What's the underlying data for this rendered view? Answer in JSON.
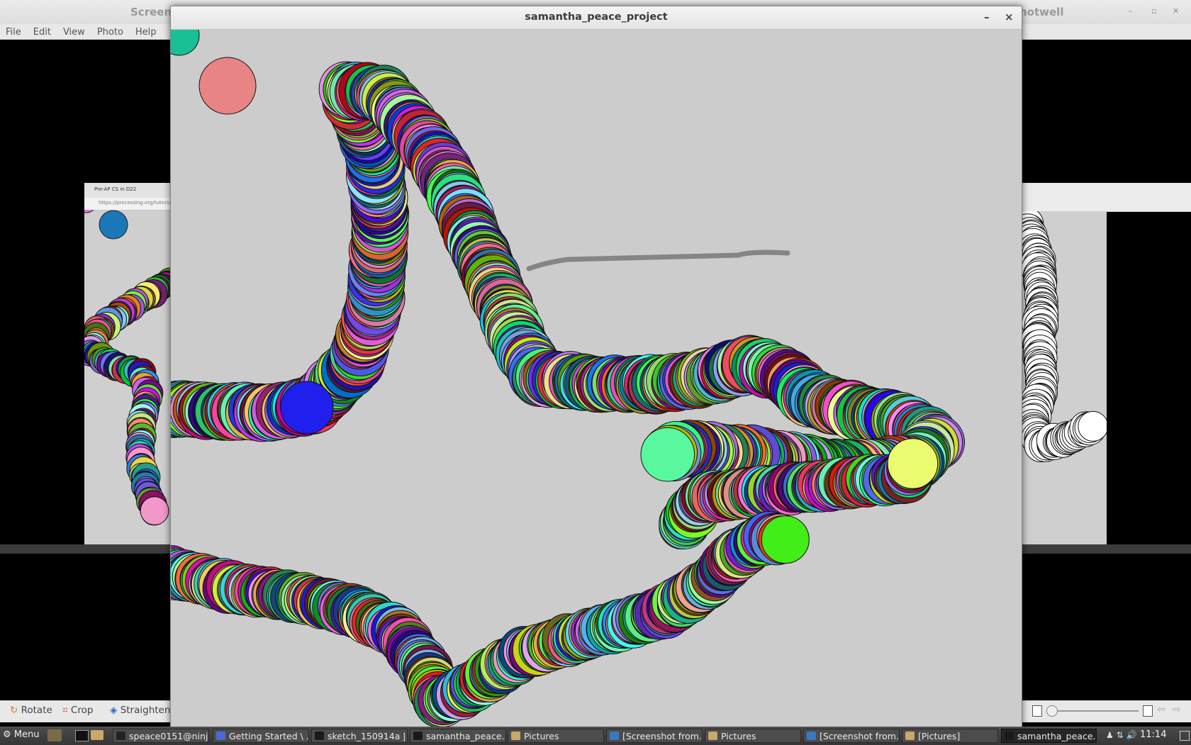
{
  "background_window": {
    "title_left": "Screens",
    "title_right": "hotwell",
    "menu": [
      "File",
      "Edit",
      "View",
      "Photo",
      "Help"
    ],
    "toolbar": [
      "Rotate",
      "Crop",
      "Straighten"
    ]
  },
  "embedded_screenshot": {
    "tab_label": "Pre-AP CS in D22",
    "url_text": "https://processing.org/tutorials"
  },
  "main_window": {
    "title": "samantha_peace_project",
    "minimize_label": "–",
    "close_label": "×"
  },
  "taskbar": {
    "menu_label": "Menu",
    "tasks": [
      {
        "label": "speace0151@ninj...",
        "icon": "terminal-icon"
      },
      {
        "label": "Getting Started \\ ...",
        "icon": "browser-icon"
      },
      {
        "label": "sketch_150914a |...",
        "icon": "processing-icon"
      },
      {
        "label": "samantha_peace...",
        "icon": "processing-icon"
      },
      {
        "label": "Pictures",
        "icon": "folder-icon"
      },
      {
        "label": "[Screenshot from...",
        "icon": "shotwell-icon"
      },
      {
        "label": "Pictures",
        "icon": "folder-icon"
      },
      {
        "label": "[Screenshot from...",
        "icon": "shotwell-icon"
      },
      {
        "label": "[Pictures]",
        "icon": "folder-icon"
      },
      {
        "label": "samantha_peace...",
        "icon": "processing-icon"
      }
    ],
    "clock": "11:14"
  }
}
